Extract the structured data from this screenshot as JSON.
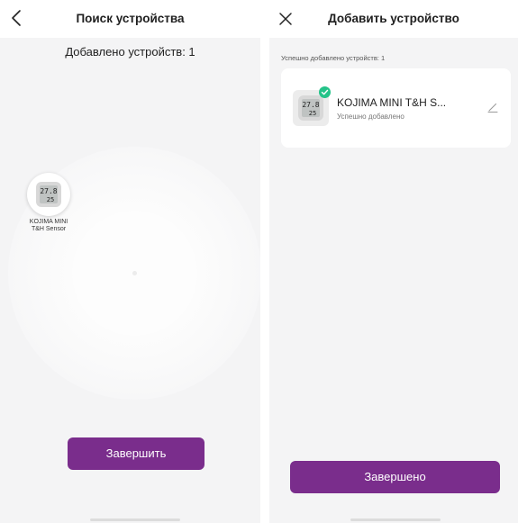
{
  "left_screen": {
    "title": "Поиск устройства",
    "added_count": "Добавлено устройств: 1",
    "found_device": {
      "label_line1": "KOJIMA MINI",
      "label_line2": "T&H Sensor",
      "display_top": "27.8",
      "display_bottom": "25"
    },
    "finish_label": "Завершить"
  },
  "right_screen": {
    "title": "Добавить устройство",
    "success_caption": "Успешно добавлено устройств: 1",
    "device": {
      "name": "KOJIMA MINI T&H S...",
      "status": "Успешно добавлено",
      "display_top": "27.8",
      "display_bottom": "25"
    },
    "done_label": "Завершено"
  },
  "colors": {
    "accent": "#7a2d8c",
    "success": "#24c389",
    "background": "#f4f4f5"
  },
  "icons": [
    "back-chevron-icon",
    "close-icon",
    "check-icon",
    "edit-pencil-icon",
    "thermometer-device-icon"
  ]
}
